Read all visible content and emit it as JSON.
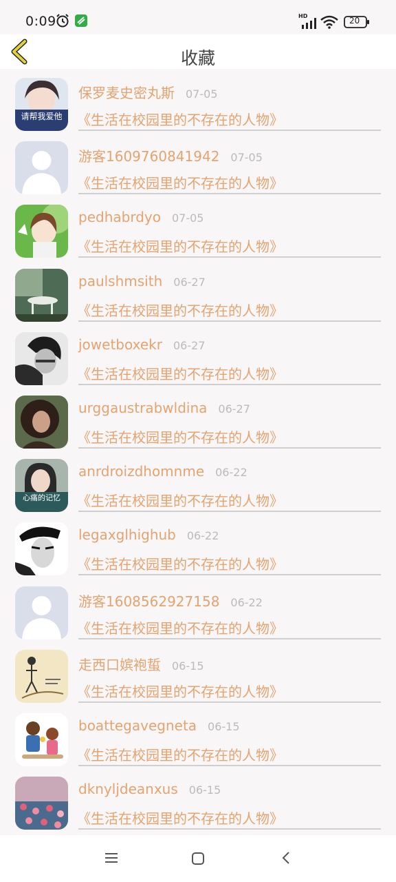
{
  "status_bar": {
    "time": "0:09",
    "network_label": "HD",
    "battery": "20"
  },
  "header": {
    "title": "收藏",
    "back_icon": "chevron-left-icon"
  },
  "favorites": [
    {
      "name": "保罗麦史密丸斯",
      "date": "07-05",
      "book": "《生活在校园里的不存在的人物》",
      "avatar": "photo-girl-caption",
      "avatar_caption": "请帮我爱他"
    },
    {
      "name": "游客1609760841942",
      "date": "07-05",
      "book": "《生活在校园里的不存在的人物》",
      "avatar": "default-person"
    },
    {
      "name": "pedhabrdyo",
      "date": "07-05",
      "book": "《生活在校园里的不存在的人物》",
      "avatar": "anime-girl"
    },
    {
      "name": "paulshmsith",
      "date": "06-27",
      "book": "《生活在校园里的不存在的人物》",
      "avatar": "garden-table"
    },
    {
      "name": "jowetboxekr",
      "date": "06-27",
      "book": "《生活在校园里的不存在的人物》",
      "avatar": "bw-portrait"
    },
    {
      "name": "urggaustrabwldina",
      "date": "06-27",
      "book": "《生活在校园里的不存在的人物》",
      "avatar": "curly-hair-woman"
    },
    {
      "name": "anrdroizdhomnme",
      "date": "06-22",
      "book": "《生活在校园里的不存在的人物》",
      "avatar": "girl-caption",
      "avatar_caption": "心痛的记忆"
    },
    {
      "name": "legaxglhighub",
      "date": "06-22",
      "book": "《生活在校园里的不存在的人物》",
      "avatar": "bw-man-cap"
    },
    {
      "name": "游客1608562927158",
      "date": "06-22",
      "book": "《生活在校园里的不存在的人物》",
      "avatar": "default-person"
    },
    {
      "name": "走西口嫔袍蜇",
      "date": "06-15",
      "book": "《生活在校园里的不存在的人物》",
      "avatar": "sketch-illustration"
    },
    {
      "name": "boattegavegneta",
      "date": "06-15",
      "book": "《生活在校园里的不存在的人物》",
      "avatar": "cartoon-couple"
    },
    {
      "name": "dknyljdeanxus",
      "date": "06-15",
      "book": "《生活在校园里的不存在的人物》",
      "avatar": "flower-field"
    }
  ],
  "nav": {
    "menu_icon": "menu-icon",
    "home_icon": "square-home-icon",
    "back_icon": "triangle-back-icon"
  },
  "colors": {
    "accent_text": "#e5a370",
    "date_text": "#bbbbbb",
    "title_text": "#444444",
    "back_arrow": "#e2d23a"
  }
}
